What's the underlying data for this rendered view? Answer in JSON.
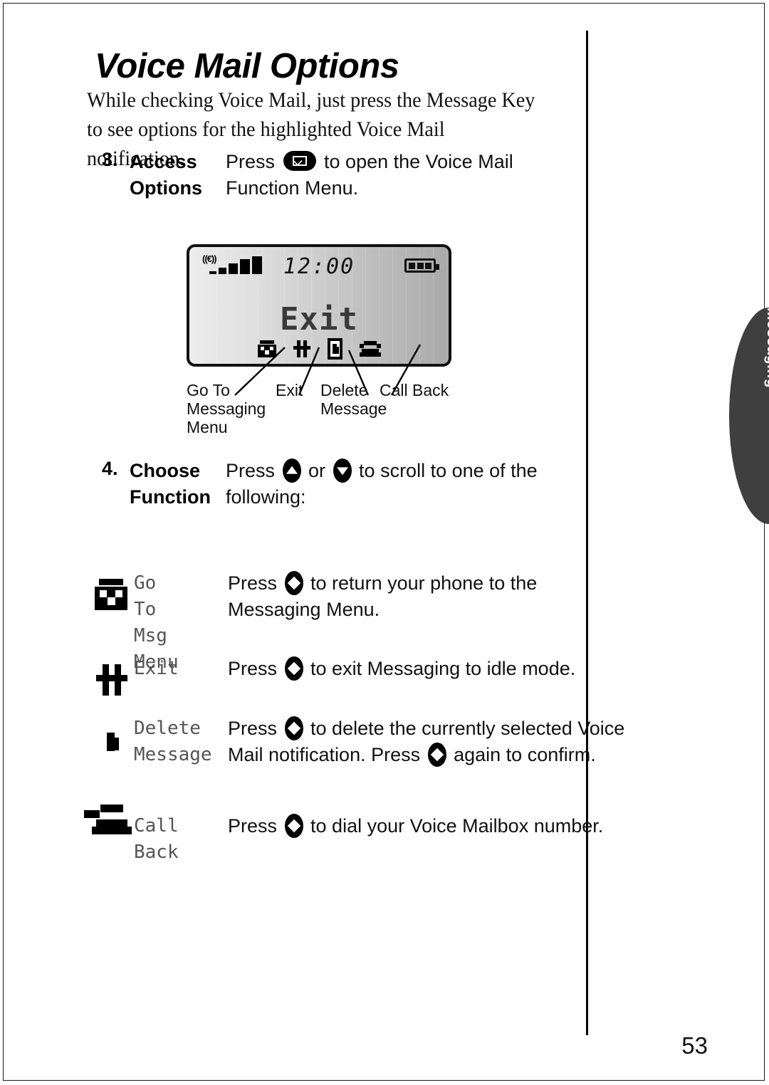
{
  "page": {
    "title": "Voice Mail Options",
    "intro": "While checking Voice Mail, just press the Message Key to see options for the highlighted Voice Mail notification.",
    "number": "53"
  },
  "side_tab": {
    "label": "Messaging",
    "color": "#3f3f3f"
  },
  "steps": [
    {
      "number": "3.",
      "label": "Access\nOptions",
      "line1_pre": "Press ",
      "line1_post": " to open the Voice Mail",
      "line2": "Function Menu.",
      "key_icon": "message-key-icon"
    },
    {
      "number": "4.",
      "label": "Choose\nFunction",
      "line1_pre": "Press ",
      "line1_mid": " or ",
      "line1_post": " to scroll to one of the",
      "line2": "following:",
      "key_icon_up": "scroll-up-key-icon",
      "key_icon_down": "scroll-down-key-icon"
    }
  ],
  "display": {
    "time": "12:00",
    "word": "Exit",
    "signal_icon": "signal-strength-icon",
    "battery_icon": "battery-full-icon",
    "battery_segments": 3,
    "signal_bars": 5,
    "icons": [
      {
        "name": "go-to-messaging-icon",
        "selected": false
      },
      {
        "name": "exit-icon",
        "selected": false
      },
      {
        "name": "delete-message-icon",
        "selected": true
      },
      {
        "name": "call-back-icon",
        "selected": false
      }
    ]
  },
  "callouts": [
    {
      "text": "Go To\nMessaging\nMenu"
    },
    {
      "text": "Exit"
    },
    {
      "text": "Delete\nMessage"
    },
    {
      "text": "Call Back"
    }
  ],
  "functions": [
    {
      "icon": "go-to-messaging-icon",
      "name": "Go To\nMsg Menu",
      "line1_pre": "Press ",
      "line1_post": " to return your phone to the",
      "line2": "Messaging Menu.",
      "select_key": "select-key-icon"
    },
    {
      "icon": "exit-icon",
      "name": "Exit",
      "line1_pre": "Press ",
      "line1_post": " to exit Messaging to idle mode.",
      "line2": "",
      "select_key": "select-key-icon"
    },
    {
      "icon": "delete-message-icon",
      "name": "Delete\nMessage",
      "line1_pre": "Press ",
      "line1_post": " to delete the currently selected Voice",
      "line2_pre": "Mail notification. Press ",
      "line2_post": " again to confirm.",
      "select_key": "select-key-icon"
    },
    {
      "icon": "call-back-icon",
      "name": "Call Back",
      "line1_pre": "Press ",
      "line1_post": " to dial your Voice Mailbox number.",
      "line2": "",
      "select_key": "select-key-icon"
    }
  ]
}
